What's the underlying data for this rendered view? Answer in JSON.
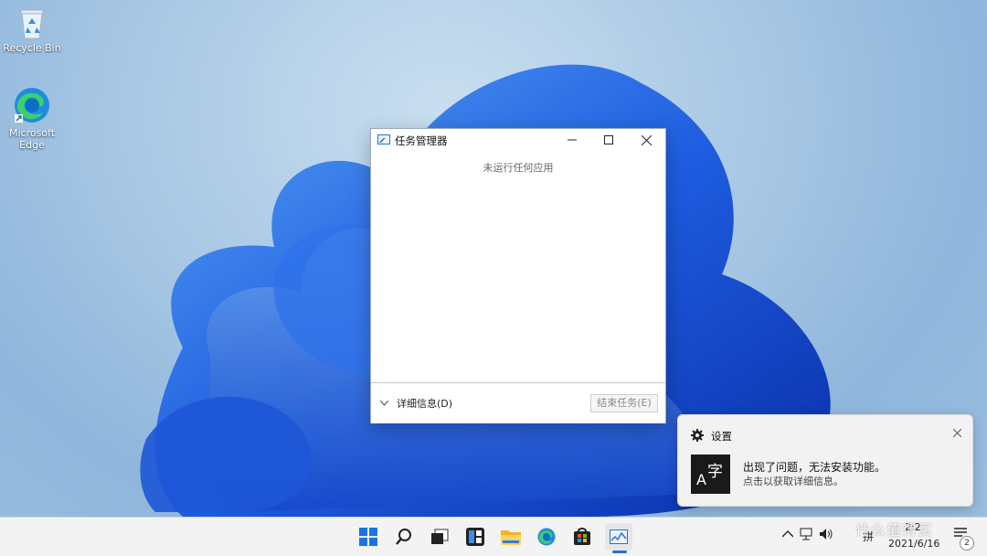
{
  "desktop": {
    "icons": [
      {
        "name": "recycle-bin",
        "label": "Recycle Bin"
      },
      {
        "name": "microsoft-edge",
        "label": "Microsoft Edge"
      }
    ]
  },
  "task_manager": {
    "title": "任务管理器",
    "empty_message": "未运行任何应用",
    "details_label": "详细信息(D)",
    "end_task_label": "结束任务(E)"
  },
  "toast": {
    "app_name": "设置",
    "title": "出现了问题，无法安装功能。",
    "body": "点击以获取详细信息。",
    "tile_glyph_a": "A",
    "tile_glyph_zi": "字"
  },
  "taskbar": {
    "pinned": [
      "start-icon",
      "search-icon",
      "task-view-icon",
      "widgets-icon",
      "file-explorer-icon",
      "edge-icon",
      "store-icon",
      "task-manager-icon"
    ],
    "ime_label": "拼",
    "time": "2:2",
    "date": "2021/6/16",
    "notification_count": "2"
  },
  "watermark": "什么值得买",
  "colors": {
    "accent": "#2a6fd0",
    "wallpaper_bloom": "#1e5de0"
  }
}
